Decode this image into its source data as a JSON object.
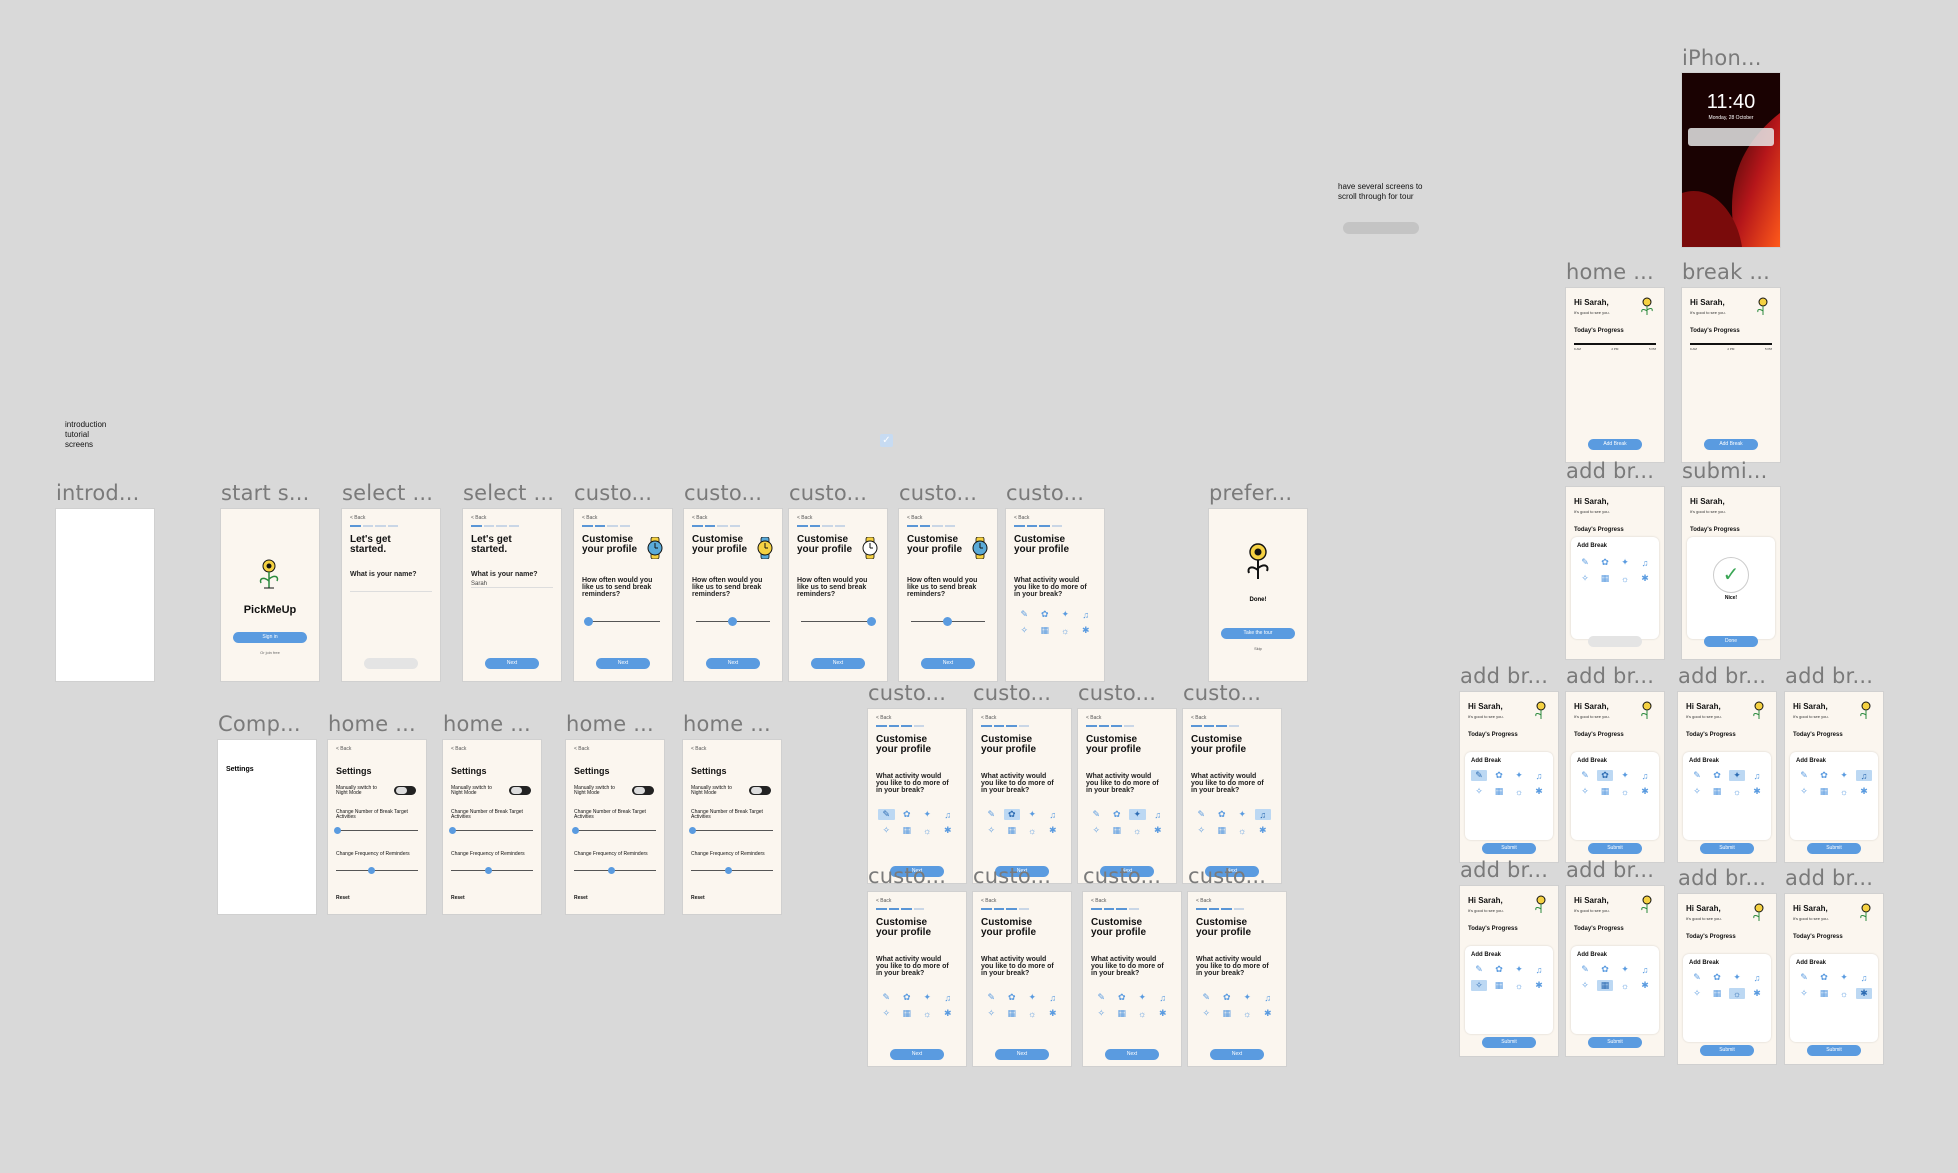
{
  "notes": {
    "intro": [
      "introduction",
      "tutorial",
      "screens"
    ],
    "tour": [
      "have several screens to",
      "scroll through for tour"
    ]
  },
  "labels": {
    "iphone": "iPhon...",
    "home": "home ...",
    "break": "break ...",
    "add_break": "add br...",
    "submit": "submi...",
    "intro": "introd...",
    "start": "start s...",
    "select": "select ...",
    "custom": "custo...",
    "prefer": "prefer...",
    "comp": "Comp..."
  },
  "screens": {
    "lockscreen": {
      "time": "11:40",
      "date": "Monday, 28 October"
    },
    "start": {
      "app_name": "PickMeUp",
      "sign_in": "Sign in",
      "sub": "Or join free"
    },
    "select": {
      "back": "< Back",
      "title_l1": "Let's get",
      "title_l2": "started.",
      "question": "What is your name?",
      "name_value": "Sarah",
      "next": "Next"
    },
    "customise": {
      "back": "< Back",
      "title_l1": "Customise",
      "title_l2": "your profile",
      "q_remind_l1": "How often would you",
      "q_remind_l2": "like us to send break",
      "q_remind_l3": "reminders?",
      "q_activity_l1": "What activity would",
      "q_activity_l2": "you like to do more of",
      "q_activity_l3": "in your break?",
      "next": "Next"
    },
    "prefer": {
      "done": "Done!",
      "btn": "Take the tour",
      "skip": "Skip"
    },
    "settings": {
      "title": "Settings",
      "night_l1": "Manually switch to",
      "night_l2": "Night Mode",
      "target_l1": "Change Number of Break Target",
      "target_l2": "Activities",
      "freq": "Change Frequency of Reminders",
      "reset": "Reset"
    },
    "home": {
      "hi": "Hi Sarah,",
      "sub": "It's good to see you.",
      "progress": "Today's Progress",
      "t1": "9 AM",
      "t2": "2 PM",
      "t3": "5 PM",
      "add_break": "Add Break",
      "add_break_btn": "Add Break",
      "submit": "Submit",
      "nice": "Nice!",
      "done": "Done"
    }
  },
  "colors": {
    "canvas": "#d9d9d9",
    "frame": "#fbf6ef",
    "accent": "#5a9be0",
    "selected": "#bcd8f3"
  }
}
